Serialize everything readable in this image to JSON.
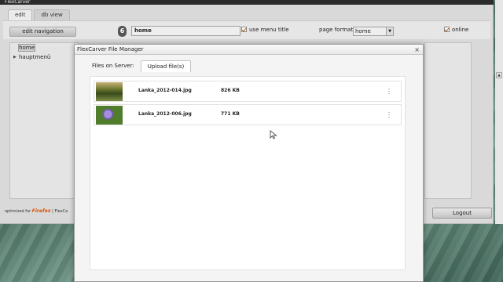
{
  "app": {
    "title": "FlexCarver",
    "tabs": [
      "edit",
      "db view"
    ],
    "edit_nav_label": "edit navigation",
    "page_value": "home",
    "use_menu_title_label": "use menu title",
    "page_format_label": "page format",
    "page_format_value": "home",
    "online_label": "online",
    "tree": {
      "root": "home",
      "child": "hauptmenü"
    },
    "footer_prefix": "optimized for",
    "footer_brand": "Firefox",
    "footer_sep": "| FlexCa",
    "logout_label": "Logout"
  },
  "modal": {
    "title": "FlexCarver File Manager",
    "close": "×",
    "tabs": [
      "Files on Server:",
      "Upload file(s)"
    ],
    "files": [
      {
        "name": "Lanka_2012-014.jpg",
        "size": "826 KB"
      },
      {
        "name": "Lanka_2012-006.jpg",
        "size": "771 KB"
      }
    ]
  },
  "colors": {
    "background": "#5f8679",
    "accent_check": "#b35a00",
    "brand": "#d35400"
  },
  "icons": [
    "logo-icon",
    "close-icon",
    "tree-expand-icon",
    "spinner-icon",
    "mouse-cursor-icon",
    "checkbox-icon",
    "dropdown-arrow-icon"
  ]
}
